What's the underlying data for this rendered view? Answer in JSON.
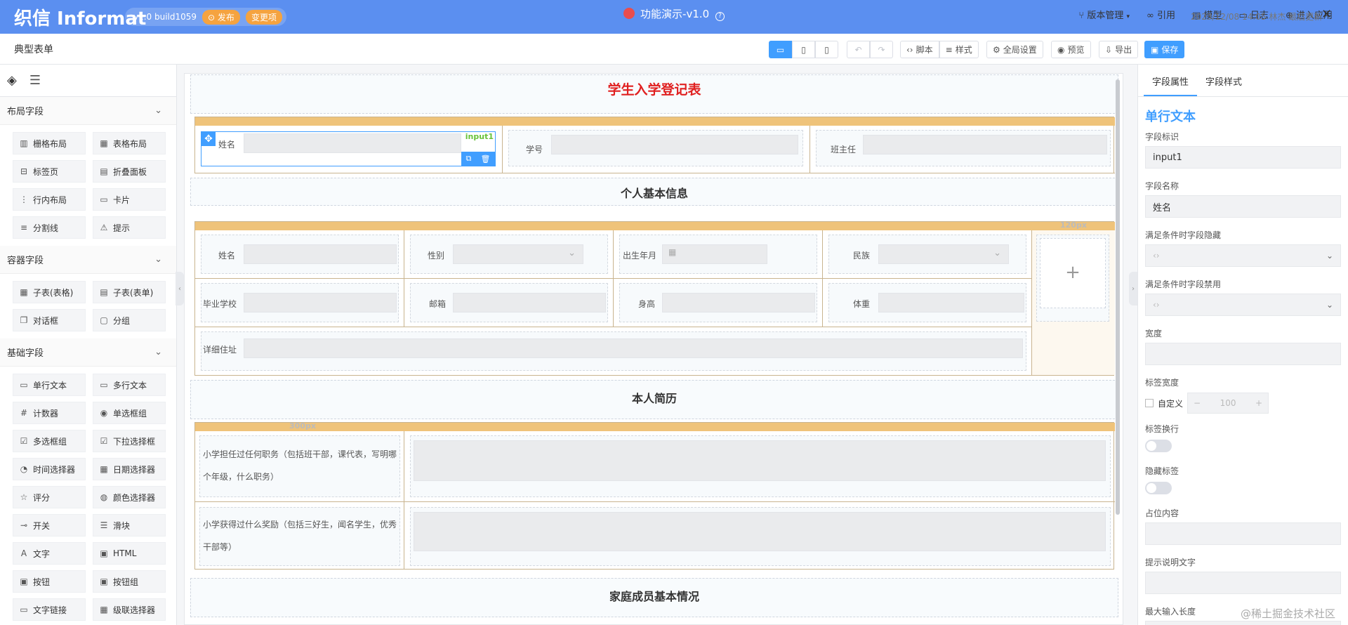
{
  "app": {
    "logo": "织信 Informat",
    "version": "v1.0 build1059",
    "publish": "发布",
    "changes": "变更项",
    "title": "功能演示-v1.0",
    "nav": [
      "版本管理",
      "引用",
      "模型",
      "日志",
      "进入应用"
    ]
  },
  "toolbar": {
    "form_name": "典型表单",
    "script": "脚本",
    "style": "样式",
    "global": "全局设置",
    "preview": "预览",
    "export": "导出",
    "save": "保存",
    "timestamp": "2023/12/08 14:05 林杰 最后更新"
  },
  "left": {
    "sections": [
      {
        "title": "布局字段",
        "items": [
          {
            "label": "栅格布局",
            "icon": "grid-icon"
          },
          {
            "label": "表格布局",
            "icon": "table-icon"
          },
          {
            "label": "标签页",
            "icon": "tabs-icon"
          },
          {
            "label": "折叠面板",
            "icon": "collapse-icon"
          },
          {
            "label": "行内布局",
            "icon": "inline-icon"
          },
          {
            "label": "卡片",
            "icon": "card-icon"
          },
          {
            "label": "分割线",
            "icon": "divider-icon"
          },
          {
            "label": "提示",
            "icon": "alert-icon"
          }
        ]
      },
      {
        "title": "容器字段",
        "items": [
          {
            "label": "子表(表格)",
            "icon": "subtable-icon"
          },
          {
            "label": "子表(表单)",
            "icon": "subform-icon"
          },
          {
            "label": "对话框",
            "icon": "dialog-icon"
          },
          {
            "label": "分组",
            "icon": "folder-icon"
          }
        ]
      },
      {
        "title": "基础字段",
        "items": [
          {
            "label": "单行文本",
            "icon": "input-icon"
          },
          {
            "label": "多行文本",
            "icon": "textarea-icon"
          },
          {
            "label": "计数器",
            "icon": "number-icon"
          },
          {
            "label": "单选框组",
            "icon": "radio-icon"
          },
          {
            "label": "多选框组",
            "icon": "checkbox-icon"
          },
          {
            "label": "下拉选择框",
            "icon": "select-icon"
          },
          {
            "label": "时间选择器",
            "icon": "clock-icon"
          },
          {
            "label": "日期选择器",
            "icon": "calendar-icon"
          },
          {
            "label": "评分",
            "icon": "star-icon"
          },
          {
            "label": "颜色选择器",
            "icon": "palette-icon"
          },
          {
            "label": "开关",
            "icon": "switch-icon"
          },
          {
            "label": "滑块",
            "icon": "slider-icon"
          },
          {
            "label": "文字",
            "icon": "text-icon"
          },
          {
            "label": "HTML",
            "icon": "html-icon"
          },
          {
            "label": "按钮",
            "icon": "button-icon"
          },
          {
            "label": "按钮组",
            "icon": "button-group-icon"
          },
          {
            "label": "文字链接",
            "icon": "link-icon"
          },
          {
            "label": "级联选择器",
            "icon": "cascader-icon"
          }
        ]
      }
    ]
  },
  "canvas": {
    "form_title": "学生入学登记表",
    "row1": {
      "f1": "姓名",
      "f2": "学号",
      "f3": "班主任",
      "selected_tag": "input1"
    },
    "sec_personal": "个人基本信息",
    "personal": {
      "col_note": "120px",
      "f": [
        "姓名",
        "性别",
        "出生年月",
        "民族",
        "毕业学校",
        "邮箱",
        "身高",
        "体重",
        "详细住址"
      ]
    },
    "sec_resume": "本人简历",
    "resume": {
      "col_note": "300px",
      "q1": "小学担任过任何职务（包括班干部，课代表，写明哪个年级，什么职务）",
      "q2": "小学获得过什么奖励（包括三好生，闻名学生，优秀干部等）"
    },
    "sec_family": "家庭成员基本情况"
  },
  "right": {
    "tabs": [
      "字段属性",
      "字段样式"
    ],
    "title": "单行文本",
    "field_id_label": "字段标识",
    "field_id": "input1",
    "field_name_label": "字段名称",
    "field_name": "姓名",
    "hide_cond": "满足条件时字段隐藏",
    "disable_cond": "满足条件时字段禁用",
    "width": "宽度",
    "label_width": "标签宽度",
    "custom": "自定义",
    "label_width_value": "100",
    "label_wrap": "标签换行",
    "hide_label": "隐藏标签",
    "placeholder": "占位内容",
    "hint": "提示说明文字",
    "max_len": "最大输入长度"
  },
  "watermark": "@稀土掘金技术社区",
  "colors": {
    "accent": "#409eff",
    "topbar": "#5b8ff0",
    "title_red": "#e02020",
    "table_bar": "#efc37a"
  }
}
